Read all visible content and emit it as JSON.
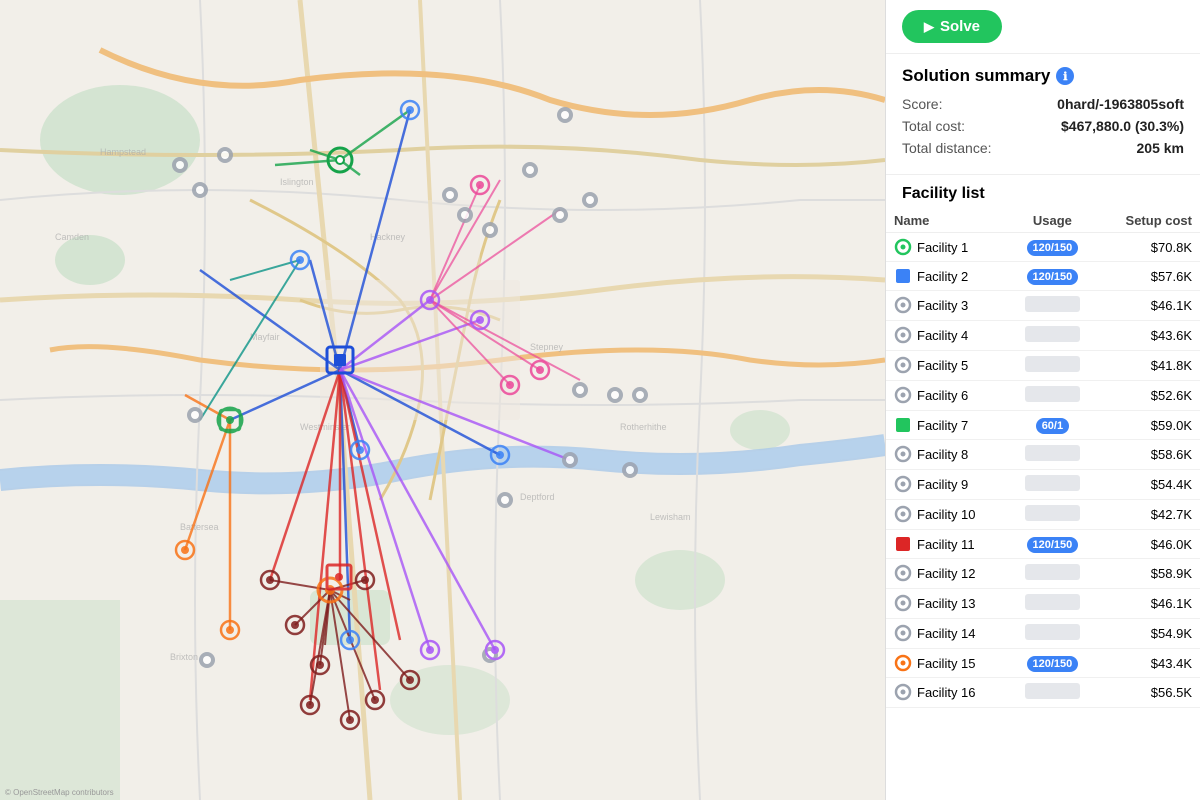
{
  "header": {
    "solve_label": "Solve"
  },
  "solution_summary": {
    "title": "Solution summary",
    "info_icon": "ℹ",
    "score_label": "Score:",
    "score_value": "0hard/-1963805soft",
    "total_cost_label": "Total cost:",
    "total_cost_value": "$467,880.0 (30.3%)",
    "total_distance_label": "Total distance:",
    "total_distance_value": "205 km"
  },
  "facility_list": {
    "title": "Facility list",
    "columns": [
      "Name",
      "Usage",
      "Setup cost"
    ],
    "items": [
      {
        "name": "Facility 1",
        "icon_color": "#22c55e",
        "icon_type": "gear",
        "usage": "120/150",
        "usage_type": "full",
        "cost": "$70.8K"
      },
      {
        "name": "Facility 2",
        "icon_color": "#3b82f6",
        "icon_type": "square",
        "usage": "120/150",
        "usage_type": "full",
        "cost": "$57.6K"
      },
      {
        "name": "Facility 3",
        "icon_color": "#9ca3af",
        "icon_type": "gear",
        "usage": "",
        "usage_type": "empty",
        "cost": "$46.1K"
      },
      {
        "name": "Facility 4",
        "icon_color": "#9ca3af",
        "icon_type": "gear",
        "usage": "",
        "usage_type": "empty",
        "cost": "$43.6K"
      },
      {
        "name": "Facility 5",
        "icon_color": "#9ca3af",
        "icon_type": "gear",
        "usage": "",
        "usage_type": "empty",
        "cost": "$41.8K"
      },
      {
        "name": "Facility 6",
        "icon_color": "#9ca3af",
        "icon_type": "gear",
        "usage": "",
        "usage_type": "empty",
        "cost": "$52.6K"
      },
      {
        "name": "Facility 7",
        "icon_color": "#22c55e",
        "icon_type": "square",
        "usage": "60/1",
        "usage_type": "partial",
        "cost": "$59.0K"
      },
      {
        "name": "Facility 8",
        "icon_color": "#9ca3af",
        "icon_type": "gear",
        "usage": "",
        "usage_type": "empty",
        "cost": "$58.6K"
      },
      {
        "name": "Facility 9",
        "icon_color": "#9ca3af",
        "icon_type": "gear",
        "usage": "",
        "usage_type": "empty",
        "cost": "$54.4K"
      },
      {
        "name": "Facility 10",
        "icon_color": "#9ca3af",
        "icon_type": "gear",
        "usage": "",
        "usage_type": "empty",
        "cost": "$42.7K"
      },
      {
        "name": "Facility 11",
        "icon_color": "#dc2626",
        "icon_type": "square",
        "usage": "120/150",
        "usage_type": "full",
        "cost": "$46.0K"
      },
      {
        "name": "Facility 12",
        "icon_color": "#9ca3af",
        "icon_type": "gear",
        "usage": "",
        "usage_type": "empty",
        "cost": "$58.9K"
      },
      {
        "name": "Facility 13",
        "icon_color": "#9ca3af",
        "icon_type": "gear",
        "usage": "",
        "usage_type": "empty",
        "cost": "$46.1K"
      },
      {
        "name": "Facility 14",
        "icon_color": "#9ca3af",
        "icon_type": "gear",
        "usage": "",
        "usage_type": "empty",
        "cost": "$54.9K"
      },
      {
        "name": "Facility 15",
        "icon_color": "#f97316",
        "icon_type": "gear",
        "usage": "120/150",
        "usage_type": "full",
        "cost": "$43.4K"
      },
      {
        "name": "Facility 16",
        "icon_color": "#9ca3af",
        "icon_type": "gear",
        "usage": "",
        "usage_type": "empty",
        "cost": "$56.5K"
      }
    ]
  },
  "map": {
    "alt": "London map with facility routes",
    "accent_color": "#3b82f6"
  }
}
